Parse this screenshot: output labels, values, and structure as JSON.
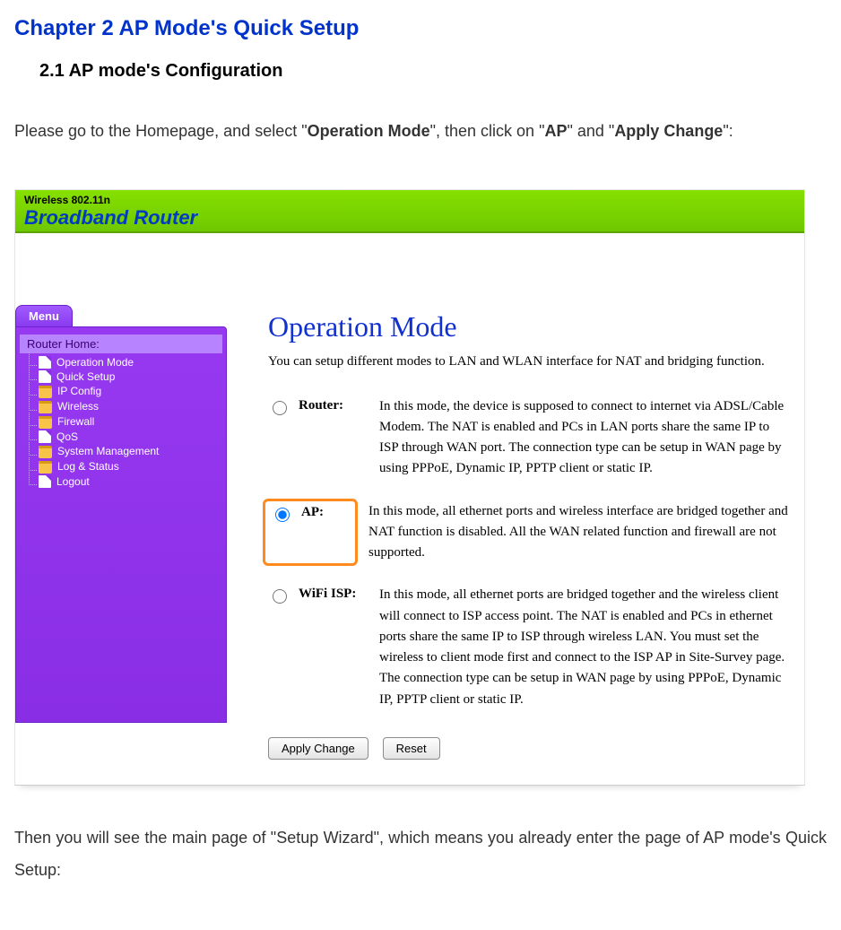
{
  "doc": {
    "chapter": "Chapter 2  AP Mode's Quick Setup",
    "section": "2.1    AP mode's Configuration",
    "intro_a": "Please go to the Homepage, and select \"",
    "intro_b": "Operation Mode",
    "intro_c": "\", then click on \"",
    "intro_d": "AP",
    "intro_e": "\" and \"",
    "intro_f": "Apply Change",
    "intro_g": "\":",
    "outro": "Then you will see the main page of \"Setup Wizard\", which means you already enter the page of AP mode's Quick Setup:"
  },
  "banner": {
    "line1": "Wireless 802.11n",
    "line2": "Broadband Router"
  },
  "sidebar": {
    "menu_label": "Menu",
    "root": "Router Home:",
    "items": [
      {
        "label": "Operation Mode",
        "icon": "page"
      },
      {
        "label": "Quick Setup",
        "icon": "page"
      },
      {
        "label": "IP Config",
        "icon": "folder"
      },
      {
        "label": "Wireless",
        "icon": "folder"
      },
      {
        "label": "Firewall",
        "icon": "folder"
      },
      {
        "label": "QoS",
        "icon": "page"
      },
      {
        "label": "System Management",
        "icon": "folder"
      },
      {
        "label": "Log & Status",
        "icon": "folder"
      },
      {
        "label": "Logout",
        "icon": "page"
      }
    ]
  },
  "pane": {
    "title": "Operation Mode",
    "subtitle": "You can setup different modes to LAN and WLAN interface for NAT and bridging function.",
    "options": [
      {
        "value": "router",
        "label": "Router:",
        "desc": "In this mode, the device is supposed to connect to internet via ADSL/Cable Modem. The NAT is enabled and PCs in LAN ports share the same IP to ISP through WAN port. The connection type can be setup in WAN page by using PPPoE, Dynamic IP, PPTP client or static IP."
      },
      {
        "value": "ap",
        "label": "AP:",
        "desc": "In this mode, all ethernet ports and wireless interface are bridged together and NAT function is disabled. All the WAN related function and firewall are not supported."
      },
      {
        "value": "wisp",
        "label": "WiFi ISP:",
        "desc": "In this mode, all ethernet ports are bridged together and the wireless client will connect to ISP access point. The NAT is enabled and PCs in ethernet ports share the same IP to ISP through wireless LAN. You must set the wireless to client mode first and connect to the ISP AP in Site-Survey page. The connection type can be setup in WAN page by using PPPoE, Dynamic IP, PPTP client or static IP."
      }
    ],
    "selected": "ap",
    "apply_label": "Apply Change",
    "reset_label": "Reset"
  }
}
